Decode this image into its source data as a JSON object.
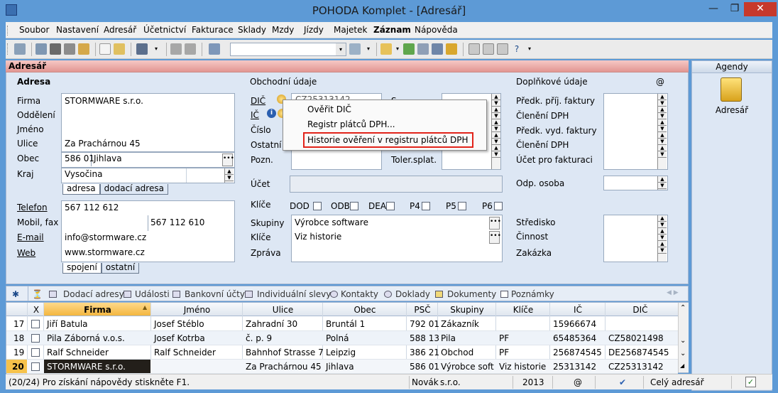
{
  "window": {
    "title": "POHODA Komplet - [Adresář]",
    "minimize": "—",
    "restore": "❐",
    "close": "✕"
  },
  "menu": [
    "Soubor",
    "Nastavení",
    "Adresář",
    "Účetnictví",
    "Fakturace",
    "Sklady",
    "Mzdy",
    "Jízdy",
    "Majetek",
    "Záznam",
    "Nápověda"
  ],
  "agenda_bar": "Adresář",
  "adresa": {
    "heading": "Adresa",
    "labels": {
      "firma": "Firma",
      "oddeleni": "Oddělení",
      "jmeno": "Jméno",
      "ulice": "Ulice",
      "obec": "Obec",
      "kraj": "Kraj"
    },
    "firma": "STORMWARE s.r.o.",
    "ulice": "Za Prachárnou 45",
    "psc": "586 01",
    "obec": "Jihlava",
    "kraj": "Vysočina",
    "tabs": [
      "adresa",
      "dodací adresa"
    ]
  },
  "kontakty": {
    "labels": {
      "telefon": "Telefon",
      "mobil": "Mobil, fax",
      "email": "E-mail",
      "web": "Web"
    },
    "telefon": "567 112 612",
    "fax": "567 112 610",
    "email": "info@stormware.cz",
    "web": "www.stormware.cz",
    "tabs": [
      "spojení",
      "ostatní"
    ]
  },
  "obchodni": {
    "heading": "Obchodní údaje",
    "labels": {
      "dic": "DIČ",
      "ic": "IČ",
      "cislo": "Číslo",
      "ostatni": "Ostatní",
      "pozn": "Pozn.",
      "toler": "Toler.splat.",
      "ucet": "Účet",
      "klice": "Klíče",
      "skupiny": "Skupiny",
      "klice2": "Klíče",
      "zprava": "Zpráva"
    },
    "dic_value": "CZ25313142",
    "flags": [
      "DOD",
      "ODB",
      "DEA",
      "P4",
      "P5",
      "P6"
    ],
    "skupiny": "Výrobce software",
    "klice": "Viz historie"
  },
  "context_menu": {
    "items": [
      "Ověřit DIČ",
      "Registr plátců DPH...",
      "Historie ověření v registru plátců DPH"
    ]
  },
  "doplnkove": {
    "heading": "Doplňkové údaje",
    "at": "@",
    "labels": [
      "Předk. příj. faktury",
      "Členění DPH",
      "Předk. vyd. faktury",
      "Členění DPH",
      "Účet pro fakturaci",
      "Odp. osoba",
      "Středisko",
      "Činnost",
      "Zakázka"
    ]
  },
  "right_panel": {
    "title": "Agendy",
    "item": "Adresář"
  },
  "subtabs": {
    "star": "✱",
    "items": [
      "Dodací adresy",
      "Události",
      "Bankovní účty",
      "Individuální slevy",
      "Kontakty",
      "Doklady",
      "Dokumenty",
      "Poznámky"
    ]
  },
  "grid": {
    "columns": [
      "X",
      "Firma",
      "Jméno",
      "Ulice",
      "Obec",
      "PSČ",
      "Skupiny",
      "Klíče",
      "IČ",
      "DIČ"
    ],
    "rows": [
      {
        "n": "17",
        "firma": "Jiří Batula",
        "jmeno": "Josef Stéblo",
        "ulice": "Zahradní 30",
        "obec": "Bruntál 1",
        "psc": "792 01",
        "skupiny": "Zákazník",
        "klice": "",
        "ic": "15966674",
        "dic": ""
      },
      {
        "n": "18",
        "firma": "Pila Záborná v.o.s.",
        "jmeno": "Josef Kotrba",
        "ulice": "č. p. 9",
        "obec": "Polná",
        "psc": "588 13",
        "skupiny": "Pila",
        "klice": "PF",
        "ic": "65485364",
        "dic": "CZ58021498"
      },
      {
        "n": "19",
        "firma": "Ralf Schneider",
        "jmeno": "Ralf Schneider",
        "ulice": "Bahnhof Strasse 7",
        "obec": "Leipzig",
        "psc": "386 21",
        "skupiny": "Obchod",
        "klice": "PF",
        "ic": "256874545",
        "dic": "DE256874545"
      },
      {
        "n": "20",
        "firma": "STORMWARE s.r.o.",
        "jmeno": "",
        "ulice": "Za Prachárnou 45",
        "obec": "Jihlava",
        "psc": "586 01",
        "skupiny": "Výrobce soft",
        "klice": "Viz historie",
        "ic": "25313142",
        "dic": "CZ25313142"
      }
    ]
  },
  "status": {
    "left": "(20/24) Pro získání nápovědy stiskněte F1.",
    "user": "Novák",
    "company": "s.r.o.",
    "year": "2013",
    "at": "@",
    "right": "Celý adresář"
  }
}
